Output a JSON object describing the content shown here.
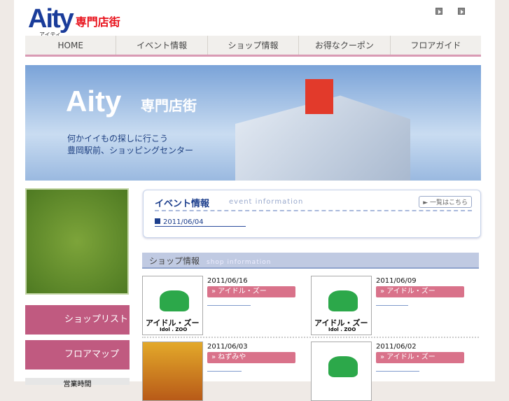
{
  "header": {
    "logo": "Aity",
    "logo_kana": "アイティ",
    "logo_sub": "専門店街"
  },
  "nav": [
    "HOME",
    "イベント情報",
    "ショップ情報",
    "お得なクーポン",
    "フロアガイド"
  ],
  "banner": {
    "title": "Aity",
    "sub": "専門店街",
    "line1": "何かイイもの探しに行こう",
    "line2": "豊岡駅前、ショッピングセンター"
  },
  "sidebar": {
    "shop_list": "ショップリスト",
    "floor_map": "フロアマップ",
    "hours": "営業時間"
  },
  "event": {
    "title": "イベント情報",
    "en": "event information",
    "more": "► 一覧はこちら",
    "items": [
      "2011/06/04"
    ]
  },
  "shop": {
    "title": "ショップ情報",
    "en": "shop information",
    "thumb_name": "アイドル・ズー",
    "thumb_sub": "Idol . ZOO",
    "items": [
      {
        "date": "2011/06/16",
        "name": "» アイドル・ズー"
      },
      {
        "date": "2011/06/09",
        "name": "» アイドル・ズー"
      },
      {
        "date": "2011/06/03",
        "name": "» ねずみや"
      },
      {
        "date": "2011/06/02",
        "name": "» アイドル・ズー"
      }
    ]
  }
}
